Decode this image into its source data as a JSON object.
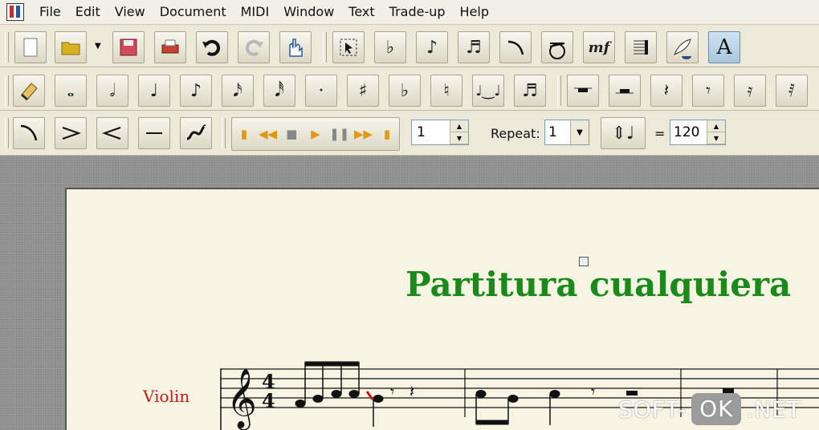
{
  "menu": {
    "items": [
      {
        "label": "File"
      },
      {
        "label": "Edit"
      },
      {
        "label": "View"
      },
      {
        "label": "Document"
      },
      {
        "label": "MIDI"
      },
      {
        "label": "Window"
      },
      {
        "label": "Text"
      },
      {
        "label": "Trade-up"
      },
      {
        "label": "Help"
      }
    ]
  },
  "toolbar3": {
    "measure_value": "1",
    "repeat_label": "Repeat:",
    "repeat_value": "1",
    "equals_label": "=",
    "tempo_value": "120"
  },
  "score": {
    "title": "Partitura cualquiera",
    "instrument": "Violin",
    "time_signature_top": "4",
    "time_signature_bottom": "4"
  },
  "watermark": {
    "left": "SOFT-",
    "pill": "OK",
    "right": ".NET"
  },
  "colors": {
    "title": "#1a8a1a",
    "instrument": "#d01818",
    "page": "#f7f4e4"
  }
}
